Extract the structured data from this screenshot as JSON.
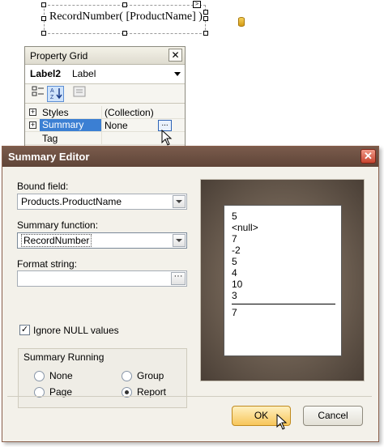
{
  "designer": {
    "label_text": "RecordNumber( [ProductName] )"
  },
  "property_grid": {
    "title": "Property Grid",
    "close_glyph": "✕",
    "object_name": "Label2",
    "object_type": "Label",
    "rows": [
      {
        "name": "Styles",
        "value": "(Collection)"
      },
      {
        "name": "Summary",
        "value": "None"
      },
      {
        "name": "Tag",
        "value": ""
      }
    ],
    "ellipsis": "..."
  },
  "dialog": {
    "title": "Summary Editor",
    "close_glyph": "✕",
    "bound_field_label": "Bound field:",
    "bound_field_value": "Products.ProductName",
    "summary_function_label": "Summary function:",
    "summary_function_value": "RecordNumber",
    "format_string_label": "Format string:",
    "format_string_value": "",
    "format_ellipsis": "···",
    "ignore_null_label": "Ignore NULL values",
    "ignore_null_checked": true,
    "summary_running_title": "Summary Running",
    "running_options": {
      "none": "None",
      "group": "Group",
      "page": "Page",
      "report": "Report",
      "selected": "Report"
    },
    "preview": {
      "lines": [
        "5",
        "<null>",
        "7",
        "-2",
        "5",
        "4",
        "10",
        "3"
      ],
      "result": "7"
    },
    "ok_label": "OK",
    "cancel_label": "Cancel"
  }
}
